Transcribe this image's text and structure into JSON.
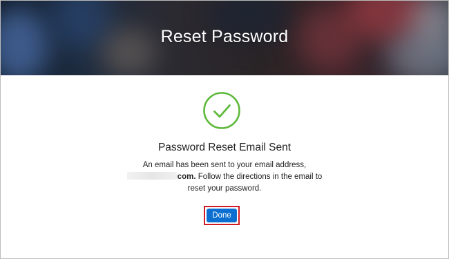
{
  "header": {
    "title": "Reset Password"
  },
  "status": {
    "icon": "success-checkmark-icon",
    "accent_color": "#5db83a",
    "heading": "Password Reset Email Sent"
  },
  "message": {
    "line1": "An email has been sent to your email address,",
    "email_visible_part": "com.",
    "line2_rest": " Follow the directions in the email to",
    "line3": "reset your password."
  },
  "actions": {
    "done_label": "Done",
    "done_color": "#0a6fd1",
    "highlight_color": "#d11a25"
  }
}
